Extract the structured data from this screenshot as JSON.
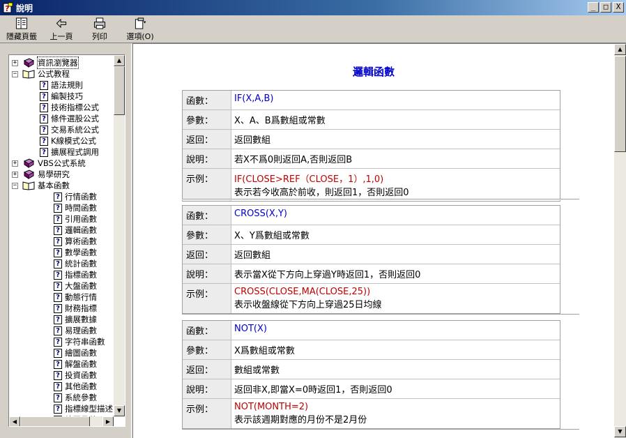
{
  "window": {
    "title": "說明",
    "min": "_",
    "max": "□",
    "close": "X"
  },
  "toolbar": {
    "hide": "隱藏頁籤",
    "back": "上一頁",
    "print": "列印",
    "options": "選項(O)"
  },
  "tree": [
    {
      "level": 0,
      "type": "book-closed",
      "expander": "+",
      "label": "資訊瀏覽器"
    },
    {
      "level": 0,
      "type": "book-open",
      "expander": "−",
      "label": "公式教程"
    },
    {
      "level": 1,
      "type": "page",
      "label": "語法規則"
    },
    {
      "level": 1,
      "type": "page",
      "label": "編製技巧"
    },
    {
      "level": 1,
      "type": "page",
      "label": "技術指標公式"
    },
    {
      "level": 1,
      "type": "page",
      "label": "條件選股公式"
    },
    {
      "level": 1,
      "type": "page",
      "label": "交易系統公式"
    },
    {
      "level": 1,
      "type": "page",
      "label": "K線模式公式"
    },
    {
      "level": 1,
      "type": "page",
      "label": "擴展程式調用"
    },
    {
      "level": 0,
      "type": "book-closed",
      "expander": "+",
      "label": "VBS公式系統"
    },
    {
      "level": 0,
      "type": "book-closed",
      "expander": "+",
      "label": "易學研究"
    },
    {
      "level": 0,
      "type": "book-open",
      "expander": "−",
      "label": "基本函數"
    },
    {
      "level": 2,
      "type": "page",
      "label": "行情函數"
    },
    {
      "level": 2,
      "type": "page",
      "label": "時間函數"
    },
    {
      "level": 2,
      "type": "page",
      "label": "引用函數"
    },
    {
      "level": 2,
      "type": "page",
      "label": "邏輯函數"
    },
    {
      "level": 2,
      "type": "page",
      "label": "算術函數"
    },
    {
      "level": 2,
      "type": "page",
      "label": "數學函數"
    },
    {
      "level": 2,
      "type": "page",
      "label": "統計函數"
    },
    {
      "level": 2,
      "type": "page",
      "label": "指標函數"
    },
    {
      "level": 2,
      "type": "page",
      "label": "大盤函數"
    },
    {
      "level": 2,
      "type": "page",
      "label": "動態行情"
    },
    {
      "level": 2,
      "type": "page",
      "label": "財務指標"
    },
    {
      "level": 2,
      "type": "page",
      "label": "擴展數據"
    },
    {
      "level": 2,
      "type": "page",
      "label": "易理函數"
    },
    {
      "level": 2,
      "type": "page",
      "label": "字符串函數"
    },
    {
      "level": 2,
      "type": "page",
      "label": "繪圖函數"
    },
    {
      "level": 2,
      "type": "page",
      "label": "解盤函數"
    },
    {
      "level": 2,
      "type": "page",
      "label": "投資函數"
    },
    {
      "level": 2,
      "type": "page",
      "label": "其他函數"
    },
    {
      "level": 2,
      "type": "page",
      "label": "系統參數"
    },
    {
      "level": 2,
      "type": "page",
      "label": "指標線型描述"
    },
    {
      "level": 2,
      "type": "page",
      "label": "繪圖函數"
    }
  ],
  "content": {
    "title": "邏輯函數",
    "labels": {
      "func": "函數：",
      "param": "參數：",
      "ret": "返回：",
      "desc": "說明：",
      "example": "示例："
    },
    "functions": [
      {
        "name": "IF(X,A,B)",
        "param": "X、A、B爲數組或常數",
        "ret": "返回數組",
        "desc": "若X不爲0則返回A,否則返回B",
        "example_code": "IF(CLOSE>REF（CLOSE，1）,1,0)",
        "example_desc": "表示若今收高於前收，則返回1，否則返回0"
      },
      {
        "name": "CROSS(X,Y)",
        "param": "X、Y爲數組或常數",
        "ret": "返回數組",
        "desc": "表示當X從下方向上穿過Y時返回1，否則返回0",
        "example_code": "CROSS(CLOSE,MA(CLOSE,25))",
        "example_desc": "表示收盤線從下方向上穿過25日均線"
      },
      {
        "name": "NOT(X)",
        "param": "X爲數組或常數",
        "ret": "數組或常數",
        "desc": "返回非X,即當X=0時返回1，否則返回0",
        "example_code": "NOT(MONTH=2)",
        "example_desc": "表示該週期對應的月份不是2月份"
      }
    ]
  }
}
